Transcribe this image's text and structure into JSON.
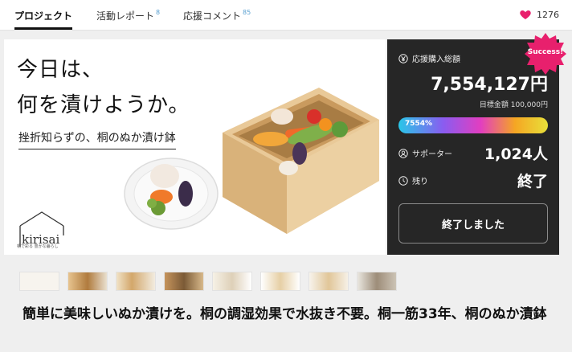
{
  "nav": {
    "tabs": [
      {
        "label": "プロジェクト",
        "count": ""
      },
      {
        "label": "活動レポート",
        "count": "8"
      },
      {
        "label": "応援コメント",
        "count": "85"
      }
    ],
    "like_count": "1276"
  },
  "hero": {
    "title_line1": "今日は、",
    "title_line2": "何を漬けようか。",
    "subtitle": "挫折知らずの、桐のぬか漬け鉢",
    "logo_text": "kirisai",
    "logo_tagline": "桐で彩る 豊かな暮らし"
  },
  "funding": {
    "badge": "Success!",
    "total_label": "応援購入総額",
    "total_amount": "7,554,127円",
    "goal_label": "目標金額 100,000円",
    "progress_label": "7554%",
    "progress_fraction": 1.0,
    "supporters_label": "サポーター",
    "supporters_value": "1,024人",
    "remaining_label": "残り",
    "remaining_value": "終了",
    "button_label": "終了しました"
  },
  "thumbnails_count": 8,
  "project_title": "簡単に美味しいぬか漬けを。桐の調湿効果で水抜き不要。桐一筋33年、桐のぬか漬鉢",
  "colors": {
    "panel_bg": "#262626",
    "badge": "#e8206d",
    "heart": "#e8206d"
  }
}
